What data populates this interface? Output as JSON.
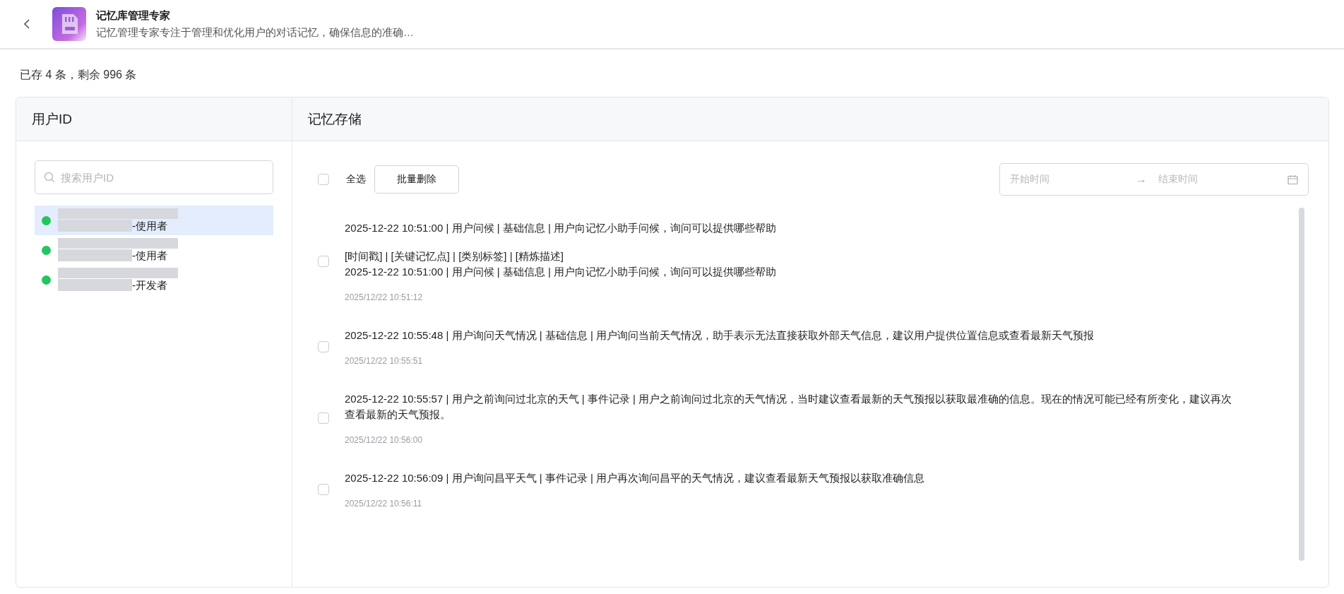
{
  "header": {
    "title": "记忆库管理专家",
    "description": "记忆管理专家专注于管理和优化用户的对话记忆，确保信息的准确…"
  },
  "summary": "已存 4 条，剩余 996 条",
  "users_panel": {
    "heading": "用户ID",
    "search": {
      "placeholder": "搜索用户ID"
    },
    "users": [
      {
        "role": "-使用者",
        "selected": true,
        "color": "#22c55e"
      },
      {
        "role": "-使用者",
        "selected": false,
        "color": "#22c55e"
      },
      {
        "role": "-开发者",
        "selected": false,
        "color": "#22c55e"
      }
    ]
  },
  "memory_panel": {
    "heading": "记忆存储",
    "select_all": {
      "label": "全选",
      "checked": false
    },
    "batch_delete": "批量删除",
    "date_range": {
      "start_placeholder": "开始时间",
      "separator": "→",
      "end_placeholder": "结束时间"
    },
    "entries": [
      {
        "checked": false,
        "paragraphs": [
          "2025-12-22 10:51:00 | 用户问候 | 基础信息 | 用户向记忆小助手问候，询问可以提供哪些帮助",
          "[时间戳] | [关键记忆点] | [类别标签] | [精炼描述]\n2025-12-22 10:51:00 | 用户问候 | 基础信息 | 用户向记忆小助手问候，询问可以提供哪些帮助"
        ],
        "time": "2025/12/22 10:51:12"
      },
      {
        "checked": false,
        "paragraphs": [
          "2025-12-22 10:55:48 | 用户询问天气情况 | 基础信息 | 用户询问当前天气情况，助手表示无法直接获取外部天气信息，建议用户提供位置信息或查看最新天气预报"
        ],
        "time": "2025/12/22 10:55:51"
      },
      {
        "checked": false,
        "paragraphs": [
          "2025-12-22 10:55:57 | 用户之前询问过北京的天气 | 事件记录 | 用户之前询问过北京的天气情况，当时建议查看最新的天气预报以获取最准确的信息。现在的情况可能已经有所变化，建议再次查看最新的天气预报。"
        ],
        "time": "2025/12/22 10:56:00"
      },
      {
        "checked": false,
        "paragraphs": [
          "2025-12-22 10:56:09 | 用户询问昌平天气 | 事件记录 | 用户再次询问昌平的天气情况，建议查看最新天气预报以获取准确信息"
        ],
        "time": "2025/12/22 10:56:11"
      }
    ]
  }
}
